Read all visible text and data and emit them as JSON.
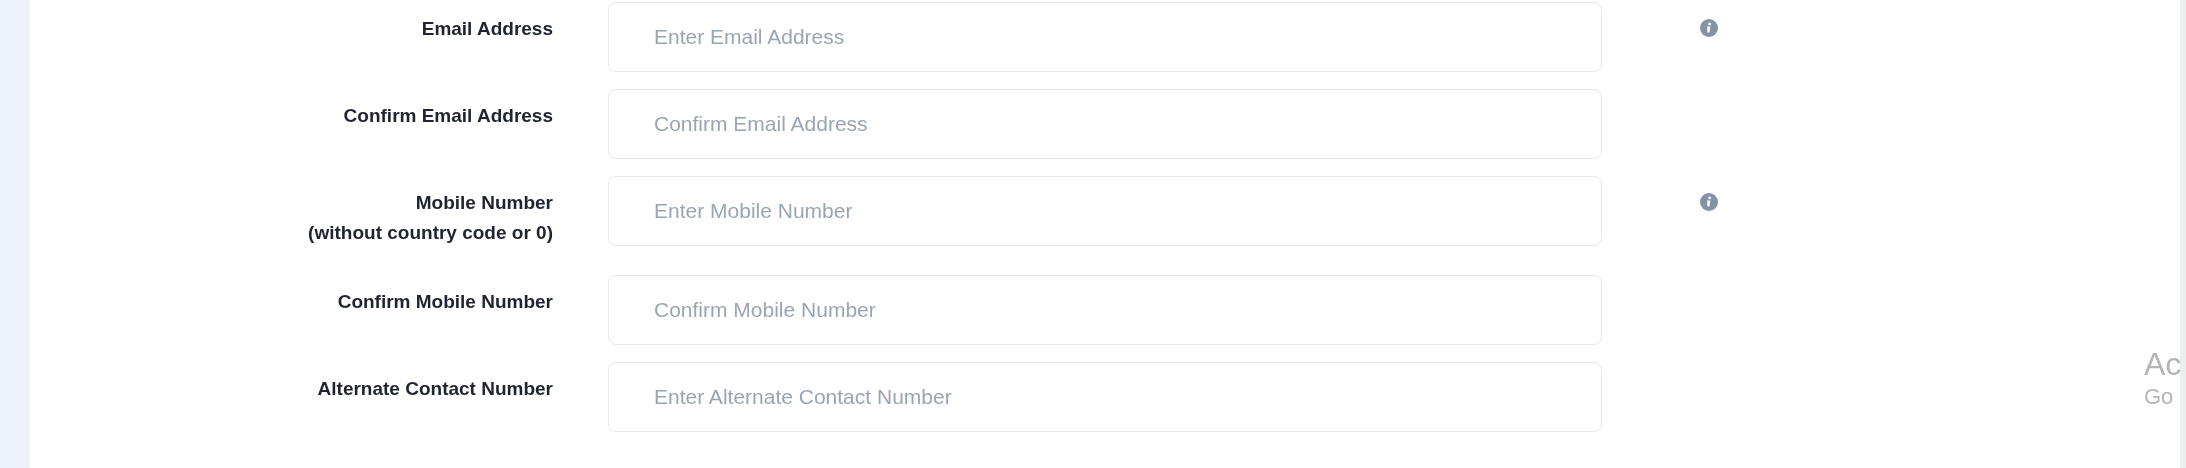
{
  "fields": [
    {
      "label": "Email Address",
      "placeholder": "Enter Email Address",
      "info": true
    },
    {
      "label": "Confirm Email Address",
      "placeholder": "Confirm Email Address",
      "info": false
    },
    {
      "label": "Mobile Number",
      "sublabel": "(without country code or 0)",
      "placeholder": "Enter Mobile Number",
      "info": true
    },
    {
      "label": "Confirm Mobile Number",
      "placeholder": "Confirm Mobile Number",
      "info": false
    },
    {
      "label": "Alternate Contact Number",
      "placeholder": "Enter Alternate Contact Number",
      "info": false
    }
  ],
  "overlay_text": [
    "Ac",
    "Go"
  ]
}
